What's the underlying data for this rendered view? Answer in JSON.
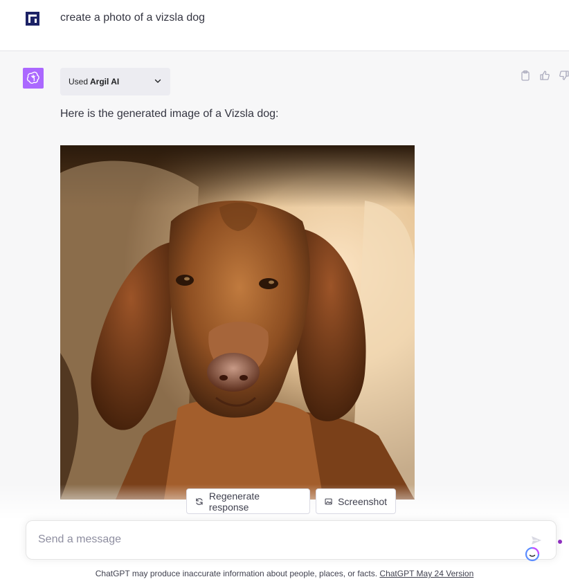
{
  "user_message": {
    "text": "create a photo of a vizsla dog",
    "avatar_icon": "user-avatar-icon"
  },
  "assistant": {
    "avatar_icon": "openai-logo-icon",
    "avatar_color": "#ab68ff",
    "plugin": {
      "used_label": "Used",
      "plugin_name": "Argil AI",
      "toggle_icon": "chevron-down-icon"
    },
    "actions": [
      "clipboard-icon",
      "thumbs-up-icon",
      "thumbs-down-icon"
    ],
    "response_text": "Here is the generated image of a Vizsla dog:",
    "image_description": "generated-vizsla-photo"
  },
  "controls": {
    "regenerate_label": "Regenerate response",
    "screenshot_label": "Screenshot"
  },
  "composer": {
    "placeholder": "Send a message",
    "send_icon": "send-icon"
  },
  "footer": {
    "disclaimer": "ChatGPT may produce inaccurate information about people, places, or facts.",
    "version_link": "ChatGPT May 24 Version"
  }
}
